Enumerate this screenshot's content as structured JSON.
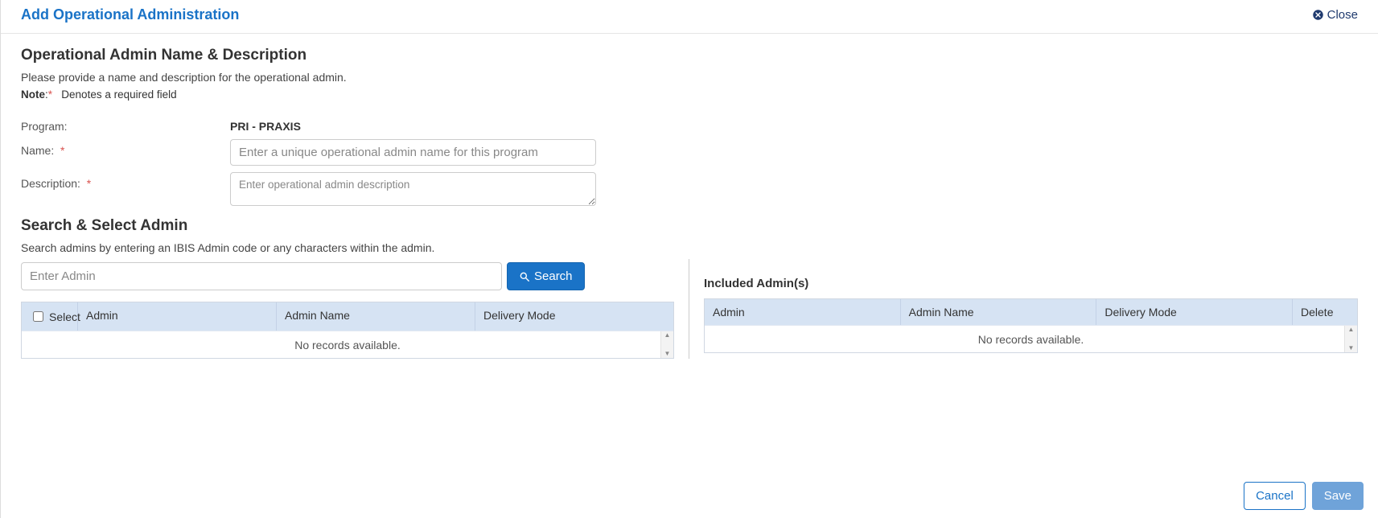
{
  "header": {
    "title": "Add Operational Administration",
    "close_label": "Close"
  },
  "section1": {
    "title": "Operational Admin Name & Description",
    "desc": "Please provide a name and description for the operational admin.",
    "note_label": "Note",
    "note_text": "Denotes a required field"
  },
  "form": {
    "program_label": "Program:",
    "program_value": "PRI - PRAXIS",
    "name_label": "Name:",
    "name_placeholder": "Enter a unique operational admin name for this program",
    "desc_label": "Description:",
    "desc_placeholder": "Enter operational admin description"
  },
  "section2": {
    "title": "Search & Select Admin",
    "desc": "Search admins by entering an IBIS Admin code or any characters within the admin."
  },
  "search": {
    "placeholder": "Enter Admin",
    "button_label": "Search"
  },
  "results_grid": {
    "col_select": "Select",
    "col_admin": "Admin",
    "col_admin_name": "Admin Name",
    "col_delivery_mode": "Delivery Mode",
    "empty": "No records available."
  },
  "included": {
    "title": "Included Admin(s)",
    "col_admin": "Admin",
    "col_admin_name": "Admin Name",
    "col_delivery_mode": "Delivery Mode",
    "col_delete": "Delete",
    "empty": "No records available."
  },
  "footer": {
    "cancel": "Cancel",
    "save": "Save"
  }
}
